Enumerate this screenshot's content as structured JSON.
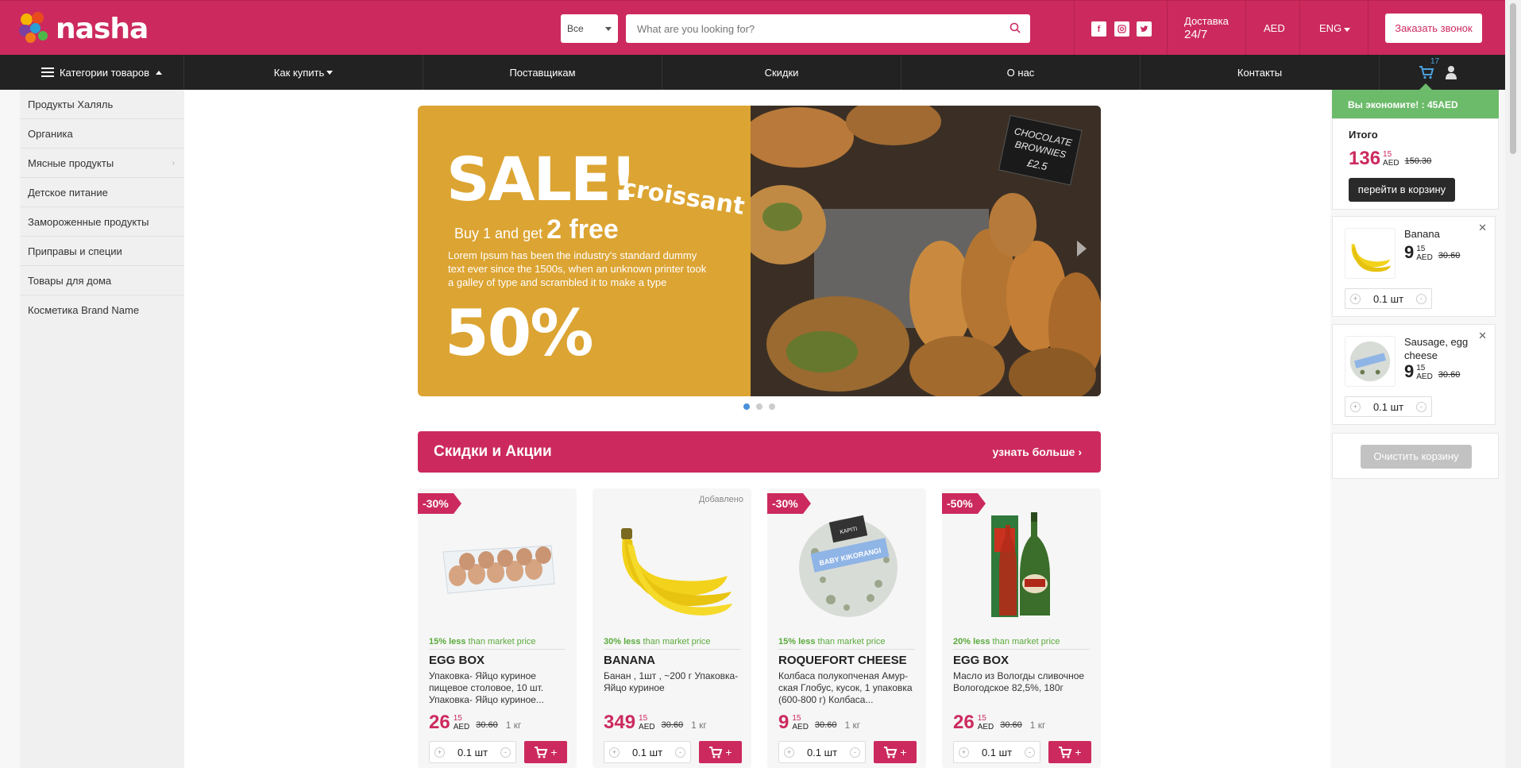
{
  "brand": {
    "name": "nasha",
    "accent": "#cc2a5e"
  },
  "header": {
    "category_select": "Все",
    "search_placeholder": "What are you looking for?",
    "social": [
      "f",
      "ig",
      "t"
    ],
    "delivery_line1": "Доставка",
    "delivery_line2": "24/7",
    "currency": "AED",
    "language": "ENG",
    "call_button": "Заказать звонок"
  },
  "nav": {
    "categories": "Категории товаров",
    "how_to_buy": "Как купить",
    "suppliers": "Поставщикам",
    "discounts": "Скидки",
    "about": "О нас",
    "contacts": "Контакты",
    "cart_count": "17"
  },
  "sidebar": {
    "items": [
      {
        "label": "Продукты Халяль"
      },
      {
        "label": "Органика"
      },
      {
        "label": "Мясные продукты"
      },
      {
        "label": "Детское питание"
      },
      {
        "label": "Замороженные продукты"
      },
      {
        "label": "Приправы и специи"
      },
      {
        "label": "Товары для дома"
      },
      {
        "label": "Косметика Brand Name"
      }
    ]
  },
  "banner": {
    "sale": "SALE!",
    "product": "croissant",
    "buy_text": "Buy 1 and get",
    "free_text": "2 free",
    "lorem": "Lorem Ipsum has been the industry's standard dummy text ever since the 1500s, when an unknown printer took a galley of type and scrambled it to make a type",
    "percent": "50%",
    "photo_sign_line1": "CHOCOLATE",
    "photo_sign_line2": "BROWNIES",
    "photo_sign_line3": "£2.5"
  },
  "promo": {
    "title": "Скидки и Акции",
    "more": "узнать больше"
  },
  "products": [
    {
      "badge": "-30%",
      "added": "",
      "less_pct": "15% less",
      "less_text": "than market price",
      "name": "EGG BOX",
      "desc": "Упаковка- Яйцо куриное пищевое столовое, 10 шт. Упаковка- Яйцо куриное...",
      "price": "26",
      "cents": "15",
      "cur": "AED",
      "old": "30.60",
      "unit": "1 кг",
      "qty": "0.1 шт"
    },
    {
      "badge": "",
      "added": "Добавлено",
      "less_pct": "30% less",
      "less_text": "than market price",
      "name": "BANANA",
      "desc": "Банан , 1шт , ~200 г Упаковка-Яйцо куриное",
      "price": "349",
      "cents": "15",
      "cur": "AED",
      "old": "30.60",
      "unit": "1 кг",
      "qty": "0.1 шт"
    },
    {
      "badge": "-30%",
      "added": "",
      "less_pct": "15% less",
      "less_text": "than market price",
      "name": "ROQUEFORT CHEESE",
      "desc": "Колбаса полукопченая Амур-ская Глобус, кусок, 1 упаковка (600-800 г) Колбаса...",
      "price": "9",
      "cents": "15",
      "cur": "AED",
      "old": "30.60",
      "unit": "1 кг",
      "qty": "0.1 шт"
    },
    {
      "badge": "-50%",
      "added": "",
      "less_pct": "20% less",
      "less_text": "than market price",
      "name": "EGG BOX",
      "desc": "Масло из Вологды сливочное Вологодское 82,5%, 180г",
      "price": "26",
      "cents": "15",
      "cur": "AED",
      "old": "30.60",
      "unit": "1 кг",
      "qty": "0.1 шт"
    }
  ],
  "product_image_labels": {
    "cheese": "BABY KIKORANGI",
    "cheese_brand": "KAPITI"
  },
  "cart": {
    "savings": "Вы экономите! : 45AED",
    "total_label": "Итого",
    "total": "136",
    "total_cents": "15",
    "cur": "AED",
    "total_old": "150.30",
    "go_button": "перейти в корзину",
    "items": [
      {
        "name": "Banana",
        "price": "9",
        "cents": "15",
        "cur": "AED",
        "old": "30.60",
        "qty": "0.1 шт"
      },
      {
        "name": "Sausage, egg cheese",
        "price": "9",
        "cents": "15",
        "cur": "AED",
        "old": "30.60",
        "qty": "0.1 шт"
      }
    ],
    "clear_button": "Очистить корзину"
  }
}
